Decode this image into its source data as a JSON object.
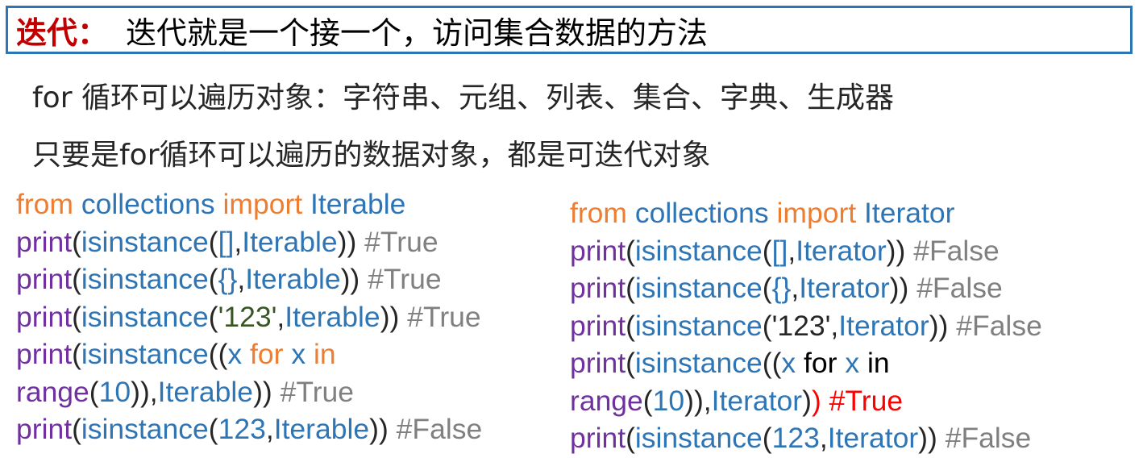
{
  "header": {
    "label": "迭代：",
    "text": "迭代就是一个接一个，访问集合数据的方法"
  },
  "lines": {
    "line1": "for 循环可以遍历对象：字符串、元组、列表、集合、字典、生成器",
    "line2": "只要是for循环可以遍历的数据对象，都是可迭代对象"
  },
  "tok": {
    "from": "from",
    "import": "import",
    "collections": "collections",
    "iterable": "Iterable",
    "iterator": "Iterator",
    "print": "print",
    "isinstance": "isinstance",
    "open": "(",
    "close": ")",
    "open2": "((",
    "close2": "))",
    "comma": ",",
    "list": "[]",
    "dict": "{}",
    "str123": "'123'",
    "x": "x",
    "for": "for",
    "in": "in",
    "range": "range",
    "ten": "10",
    "closecomma": ")),",
    "num123": "123"
  },
  "comments": {
    "true": "#True",
    "false": "#False"
  },
  "colors": {
    "keyword": "#ed7d31",
    "function": "#7030a0",
    "identifier": "#2e75b6",
    "comment": "#808080",
    "title_label": "#c00000",
    "border": "#2e75b6"
  }
}
